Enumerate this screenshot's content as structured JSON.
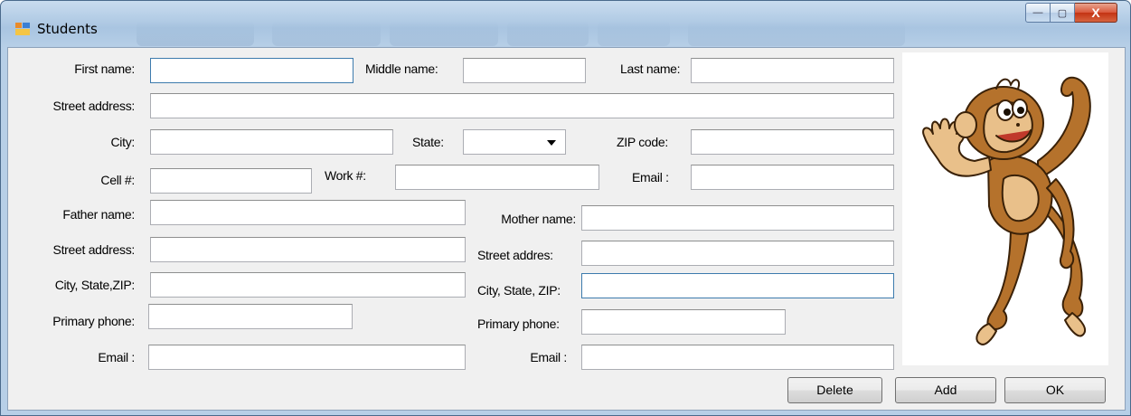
{
  "window": {
    "title": "Students",
    "close_glyph": "X",
    "min_glyph": "—",
    "max_glyph": "▢"
  },
  "labels": {
    "first_name": "First name:",
    "middle_name": "Middle name:",
    "last_name": "Last name:",
    "street_address": "Street address:",
    "city": "City:",
    "state": "State:",
    "zip_code": "ZIP code:",
    "cell": "Cell #:",
    "work": "Work #:",
    "email": "Email :",
    "father_name": "Father name:",
    "mother_name": "Mother name:",
    "father_street": "Street address:",
    "mother_street": "Street addres:",
    "father_city_state_zip": "City, State,ZIP:",
    "mother_city_state_zip": "City, State, ZIP:",
    "father_phone": "Primary phone:",
    "mother_phone": "Primary phone:",
    "father_email": "Email :",
    "mother_email": "Email :"
  },
  "fields": {
    "first_name": "",
    "middle_name": "",
    "last_name": "",
    "street_address": "",
    "city": "",
    "state": "",
    "zip_code": "",
    "cell": "",
    "work": "",
    "email": "",
    "father_name": "",
    "mother_name": "",
    "father_street": "",
    "mother_street": "",
    "father_city_state_zip": "",
    "mother_city_state_zip": "",
    "father_phone": "",
    "mother_phone": "",
    "father_email": "",
    "mother_email": ""
  },
  "buttons": {
    "delete": "Delete",
    "add": "Add",
    "ok": "OK"
  },
  "icons": {
    "app": "form-icon",
    "state_dropdown": "chevron-down-icon",
    "picture": "cartoon-monkey"
  },
  "colors": {
    "title_bar": "#a9c5e1",
    "client_bg": "#f0f0f0",
    "close_button": "#c43312",
    "monkey_fur": "#b5722c"
  }
}
